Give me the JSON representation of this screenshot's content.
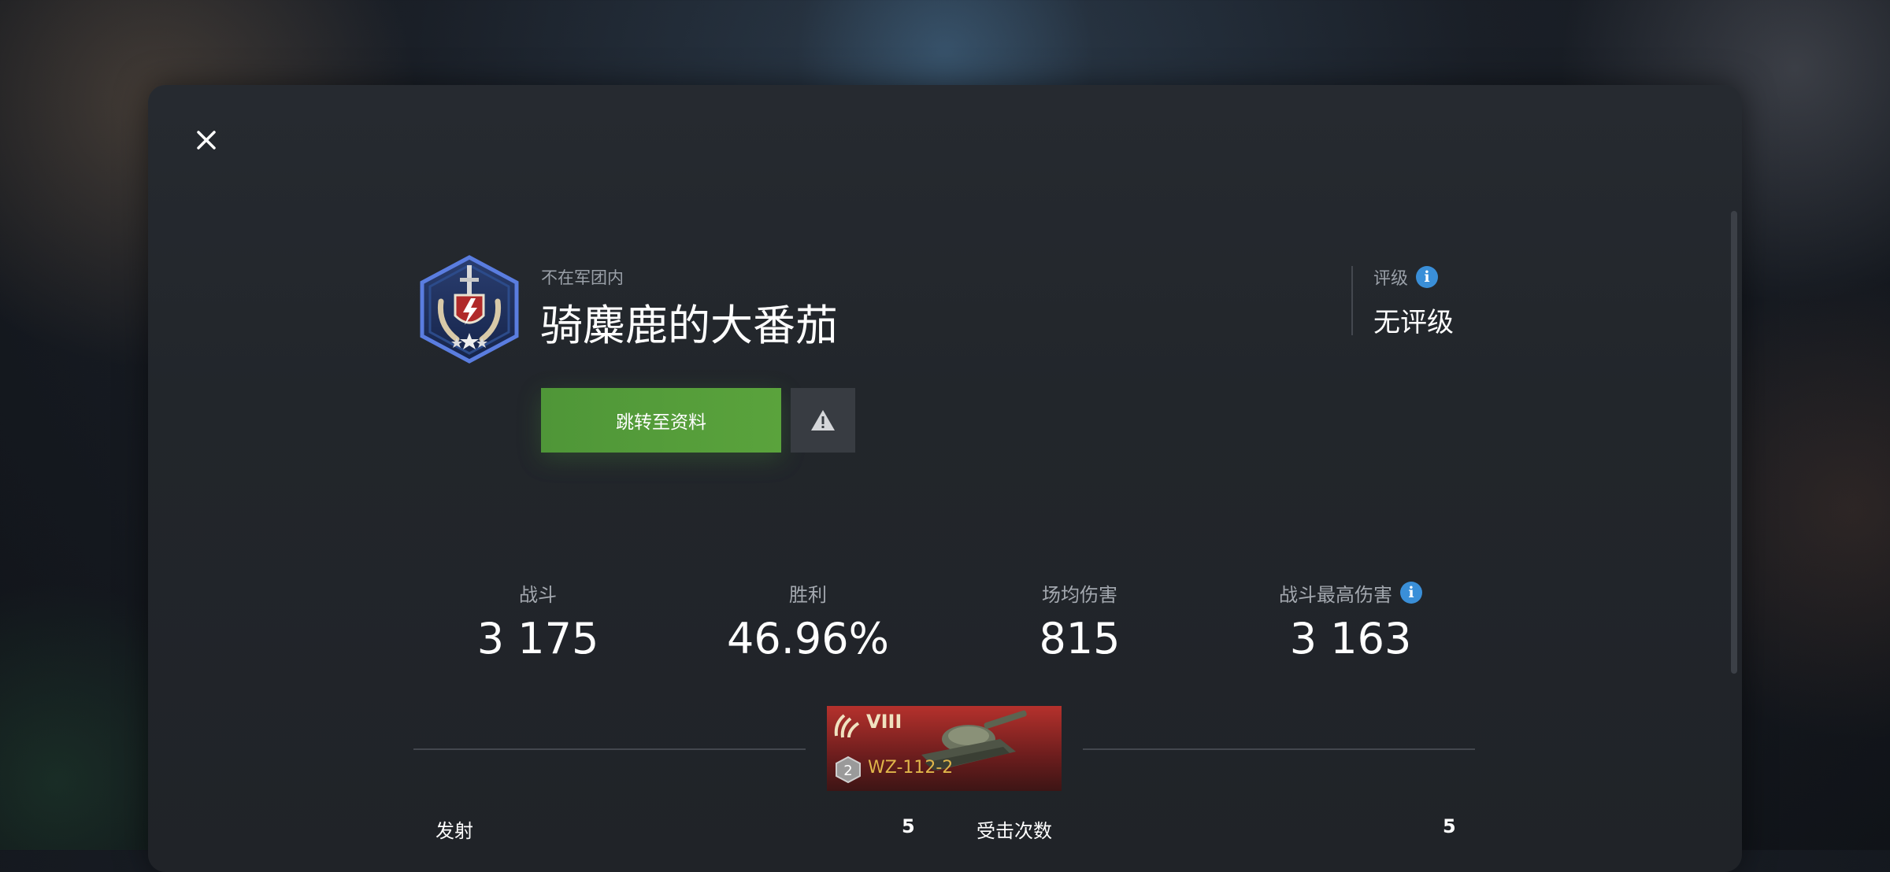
{
  "player": {
    "clan_status": "不在军团内",
    "name": "骑麋鹿的大番茄"
  },
  "rating": {
    "label": "评级",
    "value": "无评级"
  },
  "actions": {
    "profile_button": "跳转至资料"
  },
  "stats": [
    {
      "label": "战斗",
      "value": "3 175"
    },
    {
      "label": "胜利",
      "value": "46.96%"
    },
    {
      "label": "场均伤害",
      "value": "815"
    },
    {
      "label": "战斗最高伤害",
      "value": "3 163"
    }
  ],
  "tank": {
    "tier": "VIII",
    "name": "WZ-112-2",
    "mastery_level": "2"
  },
  "details": [
    {
      "label": "发射",
      "value": "5"
    },
    {
      "label": "受击次数",
      "value": "5"
    }
  ],
  "colors": {
    "accent_green": "#5aa33c",
    "info_blue": "#3a8fd8",
    "tank_card_red": "#b5312c",
    "tank_name_gold": "#e0b64a"
  },
  "icons": {
    "close": "close-icon",
    "emblem": "rank-emblem-icon",
    "info": "info-icon",
    "report": "warning-icon",
    "tier": "tier-laurel-icon",
    "mastery": "mastery-badge-icon"
  }
}
